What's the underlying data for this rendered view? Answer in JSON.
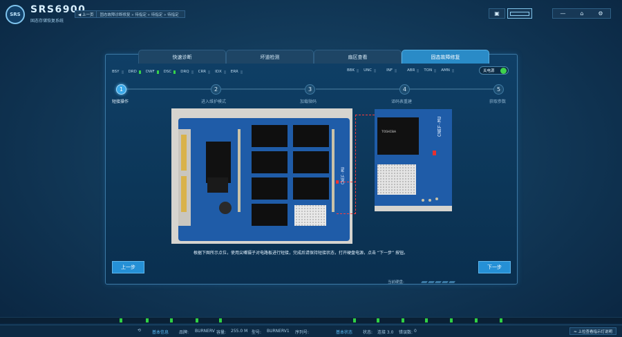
{
  "app": {
    "logo_text": "SRS",
    "name": "SRS6900",
    "subtitle": "固态存储恢复系统"
  },
  "breadcrumb": {
    "back": "◀ 上一页",
    "path": "固态故障诊断修复 » 待指定 » 待指定 » 待指定"
  },
  "window_buttons": {
    "minimize": "—",
    "home": "⌂",
    "settings": "⚙",
    "toolbox": "▣"
  },
  "tabs": [
    {
      "label": "快速诊断",
      "active": false
    },
    {
      "label": "坏道检测",
      "active": false
    },
    {
      "label": "扇区查看",
      "active": false
    },
    {
      "label": "固态故障修复",
      "active": true
    }
  ],
  "status_flags_left": [
    {
      "name": "BSY",
      "on": false
    },
    {
      "name": "DRD",
      "on": true
    },
    {
      "name": "DWF",
      "on": true
    },
    {
      "name": "DSC",
      "on": true
    },
    {
      "name": "DRQ",
      "on": false
    },
    {
      "name": "CRR",
      "on": false
    },
    {
      "name": "IDX",
      "on": false
    },
    {
      "name": "ERR",
      "on": false
    }
  ],
  "status_flags_right": [
    {
      "name": "BBK",
      "on": false
    },
    {
      "name": "UNC",
      "on": false
    },
    {
      "name": "INF",
      "on": false
    },
    {
      "name": "ABR",
      "on": false
    },
    {
      "name": "TON",
      "on": false
    },
    {
      "name": "AMN",
      "on": false
    }
  ],
  "power_toggle": {
    "label": "关电源",
    "on": true
  },
  "steps": [
    {
      "number": "1",
      "label": "短接操作",
      "active": true
    },
    {
      "number": "2",
      "label": "进入维护模式",
      "active": false
    },
    {
      "number": "3",
      "label": "加载微码",
      "active": false
    },
    {
      "number": "4",
      "label": "译码表重建",
      "active": false
    },
    {
      "number": "5",
      "label": "获取参数",
      "active": false
    }
  ],
  "instruction": "根据下图所示点位，使用尖嘴镊子对电路板进行短接，完成后请保持短接状态，打开硬盘电源，点击 “下一步” 按钮。",
  "buttons": {
    "prev": "上一步",
    "next": "下一步"
  },
  "panel_footer": {
    "current_disk_label": "当前硬盘:"
  },
  "bottom_bar": {
    "basic_info_title": "基本信息",
    "brand_label": "品牌:",
    "brand_value": "BURNERV",
    "capacity_label": "容量:",
    "capacity_value": "255.0 M",
    "model_label": "型号:",
    "model_value": "BURNERV1",
    "serial_label": "序列号:",
    "serial_value": "",
    "basic_status_title": "基本状态",
    "state_label": "状态:",
    "state_value": "连接 3.0",
    "errors_label": "错误数:",
    "errors_value": "0",
    "hint": "≈ 上拉查看指示灯说明"
  },
  "colors": {
    "accent": "#2590d6",
    "led_on": "#36d24a",
    "pcb": "#1f5ca8",
    "marker": "#ff3b3b"
  }
}
